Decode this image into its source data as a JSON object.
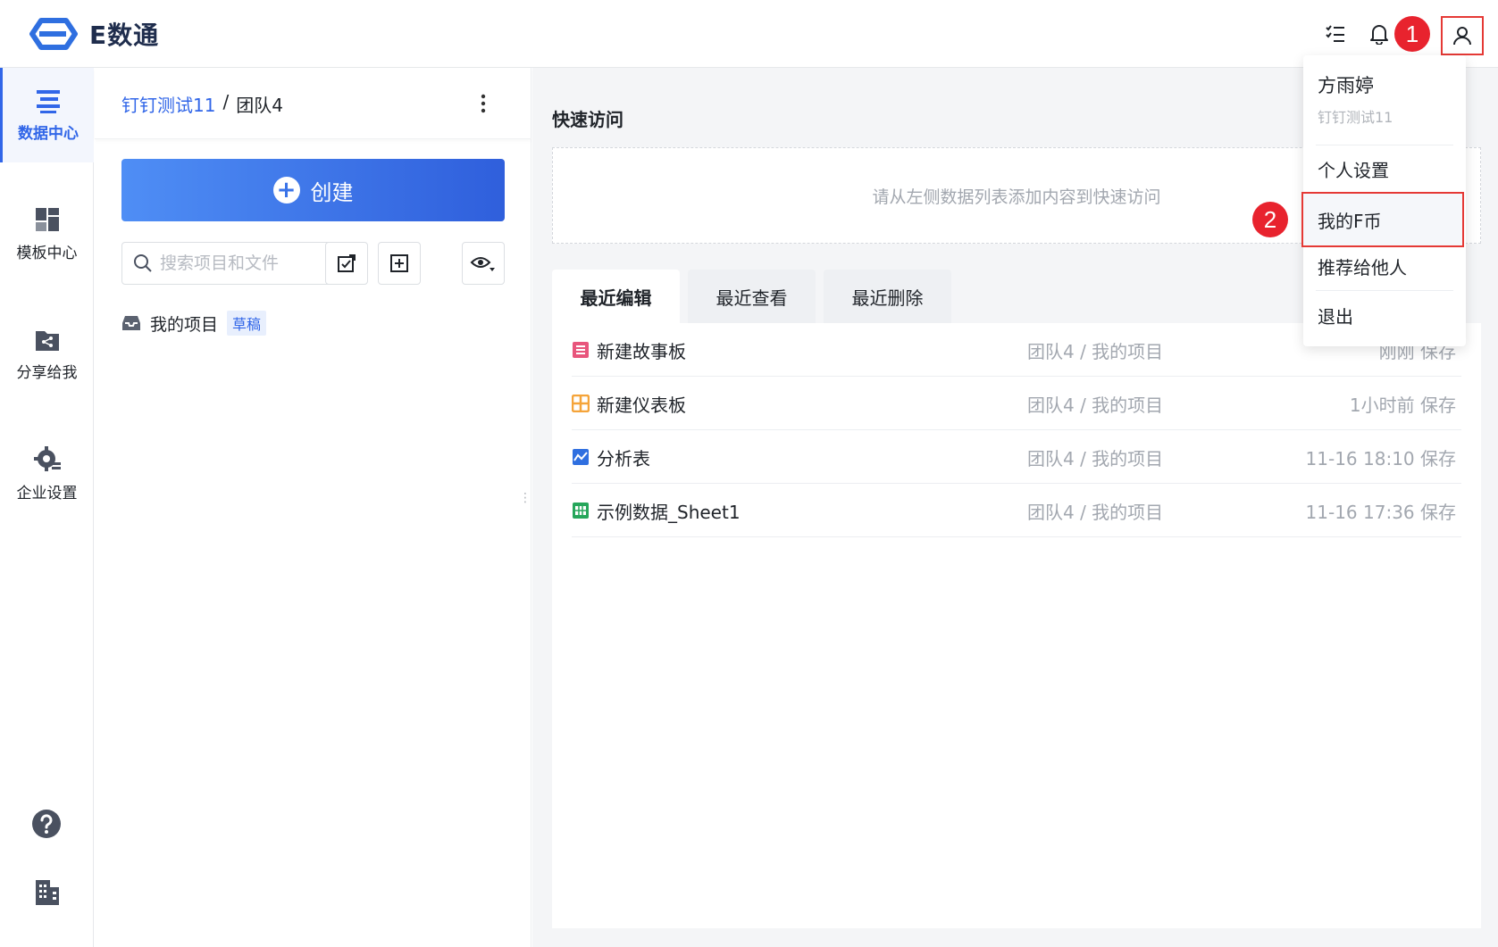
{
  "app": {
    "brand": "E数通"
  },
  "header": {
    "badge1": "1",
    "badge2": "2"
  },
  "leftnav": {
    "items": [
      {
        "label": "数据中心",
        "active": true
      },
      {
        "label": "模板中心"
      },
      {
        "label": "分享给我"
      },
      {
        "label": "企业设置"
      }
    ]
  },
  "mid": {
    "breadcrumb": {
      "team": "钉钉测试11",
      "sep": "/",
      "current": "团队4"
    },
    "create_label": "创建",
    "search": {
      "placeholder": "搜索项目和文件",
      "value": ""
    },
    "project": {
      "name": "我的项目",
      "tag": "草稿"
    }
  },
  "main": {
    "quick_access_title": "快速访问",
    "quick_access_hint": "请从左侧数据列表添加内容到快速访问",
    "tabs": [
      {
        "label": "最近编辑",
        "active": true
      },
      {
        "label": "最近查看"
      },
      {
        "label": "最近删除"
      }
    ],
    "rows": [
      {
        "name": "新建故事板",
        "path": "团队4 / 我的项目",
        "time": "刚刚 保存",
        "icon": "storyboard-icon",
        "color": "#e8557c"
      },
      {
        "name": "新建仪表板",
        "path": "团队4 / 我的项目",
        "time": "1小时前 保存",
        "icon": "dashboard-icon",
        "color": "#f5a43a"
      },
      {
        "name": "分析表",
        "path": "团队4 / 我的项目",
        "time": "11-16 18:10 保存",
        "icon": "analysis-icon",
        "color": "#2f6fe0"
      },
      {
        "name": "示例数据_Sheet1",
        "path": "团队4 / 我的项目",
        "time": "11-16 17:36 保存",
        "icon": "sheet-icon",
        "color": "#26a65b"
      }
    ]
  },
  "dropdown": {
    "user_name": "方雨婷",
    "org": "钉钉测试11",
    "items": [
      "个人设置",
      "我的F币",
      "推荐给他人",
      "退出"
    ]
  },
  "colors": {
    "accent": "#3166e8",
    "highlight": "#e53935",
    "badge": "#e8232e"
  }
}
